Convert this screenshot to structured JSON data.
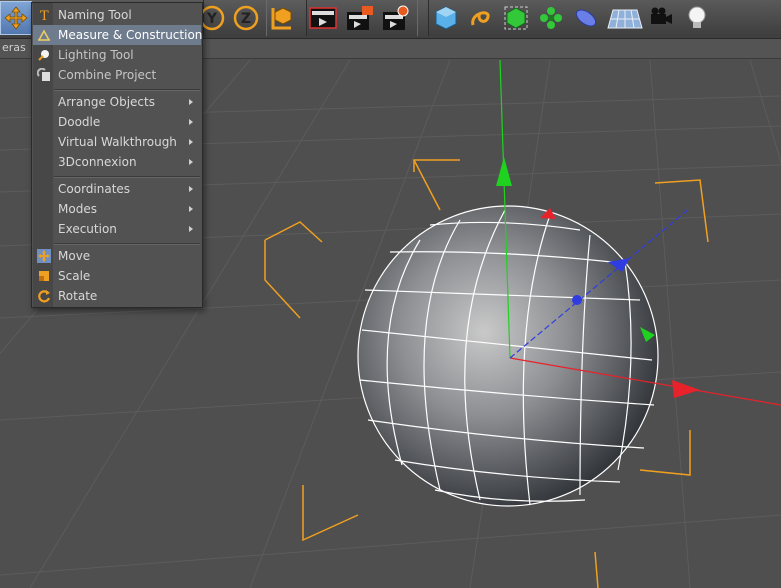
{
  "viewport_header": {
    "menu_label": "eras"
  },
  "toolbar": {
    "axis_y_label": "Y",
    "axis_z_label": "Z",
    "buttons": [
      "move-tool-icon",
      "y-axis-icon",
      "z-axis-icon",
      "coordinate-system-icon",
      "render-view-icon",
      "render-picture-viewer-icon",
      "edit-render-settings-icon",
      "cube-icon",
      "spline-icon",
      "nurbs-icon",
      "array-icon",
      "deformer-icon",
      "floor-icon",
      "camera-icon",
      "light-icon"
    ]
  },
  "menu": {
    "items": [
      {
        "label": "Naming Tool",
        "icon": "naming-tool-icon"
      },
      {
        "label": "Measure & Construction",
        "icon": "measure-icon",
        "highlighted": true
      },
      {
        "label": "Lighting Tool",
        "icon": "lighting-tool-icon"
      },
      {
        "label": "Combine Project",
        "icon": "combine-project-icon"
      },
      {
        "label": "Arrange Objects",
        "submenu": true
      },
      {
        "label": "Doodle",
        "submenu": true
      },
      {
        "label": "Virtual Walkthrough",
        "submenu": true
      },
      {
        "label": "3Dconnexion",
        "submenu": true
      },
      {
        "label": "Coordinates",
        "submenu": true
      },
      {
        "label": "Modes",
        "submenu": true
      },
      {
        "label": "Execution",
        "submenu": true
      },
      {
        "label": "Move",
        "icon": "move-icon"
      },
      {
        "label": "Scale",
        "icon": "scale-icon"
      },
      {
        "label": "Rotate",
        "icon": "rotate-icon"
      }
    ]
  },
  "colors": {
    "viewport_bg": "#4f4f4f",
    "menu_highlight": "#6e7c8e",
    "axis_x": "#e8222a",
    "axis_y": "#1fd21f",
    "axis_z": "#2f3de0",
    "bbox": "#f0a020"
  }
}
